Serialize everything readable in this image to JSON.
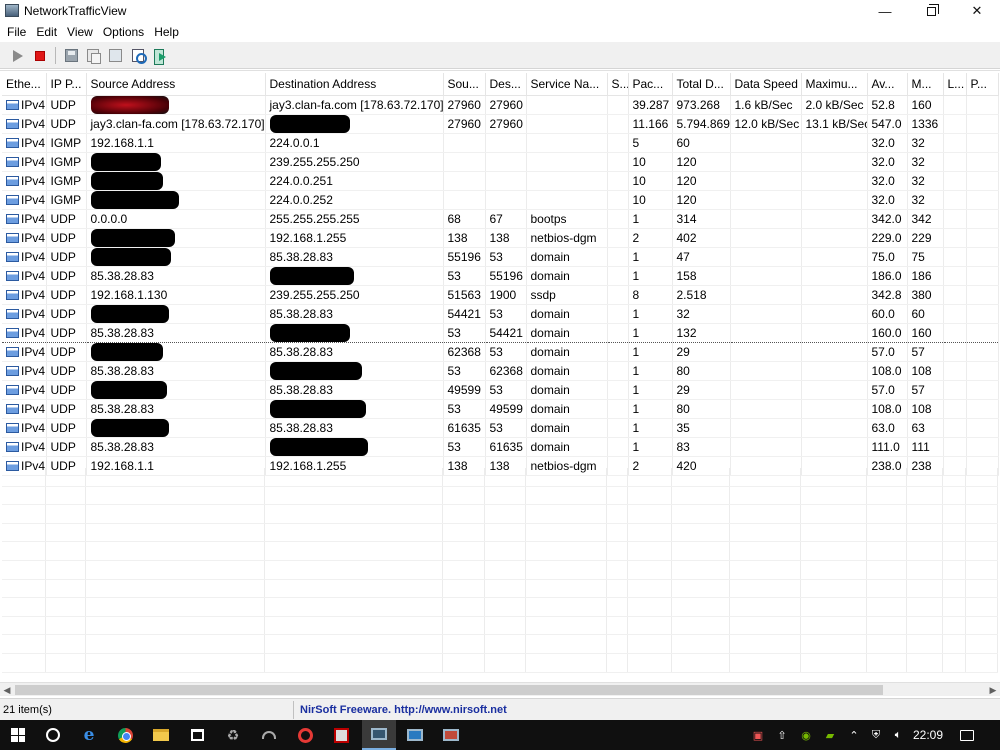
{
  "window": {
    "title": "NetworkTrafficView"
  },
  "menu": [
    "File",
    "Edit",
    "View",
    "Options",
    "Help"
  ],
  "toolbar": {
    "icons": [
      "play-icon",
      "stop-icon",
      "save-icon",
      "copy-icon",
      "html-report-icon",
      "properties-icon",
      "exit-icon"
    ]
  },
  "table": {
    "columns": [
      "Ethe...",
      "IP P...",
      "Source Address",
      "Destination Address",
      "Sou...",
      "Des...",
      "Service Na...",
      "S...",
      "Pac...",
      "Total D...",
      "Data Speed",
      "Maximu...",
      "Av...",
      "M...",
      "L...",
      "P..."
    ],
    "rows": [
      [
        "IPv4",
        "UDP",
        "",
        "jay3.clan-fa.com  [178.63.72.170]",
        "27960",
        "27960",
        "",
        "",
        "39.287",
        "973.268",
        "1.6 kB/Sec",
        "2.0 kB/Sec",
        "52.8",
        "160",
        "",
        ""
      ],
      [
        "IPv4",
        "UDP",
        "jay3.clan-fa.com  [178.63.72.170]",
        "",
        "27960",
        "27960",
        "",
        "",
        "11.166",
        "5.794.869",
        "12.0 kB/Sec",
        "13.1 kB/Sec",
        "547.0",
        "1336",
        "",
        ""
      ],
      [
        "IPv4",
        "IGMP",
        "192.168.1.1",
        "224.0.0.1",
        "",
        "",
        "",
        "",
        "5",
        "60",
        "",
        "",
        "32.0",
        "32",
        "",
        ""
      ],
      [
        "IPv4",
        "IGMP",
        "",
        "239.255.255.250",
        "",
        "",
        "",
        "",
        "10",
        "120",
        "",
        "",
        "32.0",
        "32",
        "",
        ""
      ],
      [
        "IPv4",
        "IGMP",
        "",
        "224.0.0.251",
        "",
        "",
        "",
        "",
        "10",
        "120",
        "",
        "",
        "32.0",
        "32",
        "",
        ""
      ],
      [
        "IPv4",
        "IGMP",
        "",
        "224.0.0.252",
        "",
        "",
        "",
        "",
        "10",
        "120",
        "",
        "",
        "32.0",
        "32",
        "",
        ""
      ],
      [
        "IPv4",
        "UDP",
        "0.0.0.0",
        "255.255.255.255",
        "68",
        "67",
        "bootps",
        "",
        "1",
        "314",
        "",
        "",
        "342.0",
        "342",
        "",
        ""
      ],
      [
        "IPv4",
        "UDP",
        "",
        "192.168.1.255",
        "138",
        "138",
        "netbios-dgm",
        "",
        "2",
        "402",
        "",
        "",
        "229.0",
        "229",
        "",
        ""
      ],
      [
        "IPv4",
        "UDP",
        "",
        "85.38.28.83",
        "55196",
        "53",
        "domain",
        "",
        "1",
        "47",
        "",
        "",
        "75.0",
        "75",
        "",
        ""
      ],
      [
        "IPv4",
        "UDP",
        "85.38.28.83",
        "",
        "53",
        "55196",
        "domain",
        "",
        "1",
        "158",
        "",
        "",
        "186.0",
        "186",
        "",
        ""
      ],
      [
        "IPv4",
        "UDP",
        "192.168.1.130",
        "239.255.255.250",
        "51563",
        "1900",
        "ssdp",
        "",
        "8",
        "2.518",
        "",
        "",
        "342.8",
        "380",
        "",
        ""
      ],
      [
        "IPv4",
        "UDP",
        "",
        "85.38.28.83",
        "54421",
        "53",
        "domain",
        "",
        "1",
        "32",
        "",
        "",
        "60.0",
        "60",
        "",
        ""
      ],
      [
        "IPv4",
        "UDP",
        "85.38.28.83",
        "",
        "53",
        "54421",
        "domain",
        "",
        "1",
        "132",
        "",
        "",
        "160.0",
        "160",
        "",
        ""
      ],
      [
        "IPv4",
        "UDP",
        "",
        "85.38.28.83",
        "62368",
        "53",
        "domain",
        "",
        "1",
        "29",
        "",
        "",
        "57.0",
        "57",
        "",
        ""
      ],
      [
        "IPv4",
        "UDP",
        "85.38.28.83",
        "",
        "53",
        "62368",
        "domain",
        "",
        "1",
        "80",
        "",
        "",
        "108.0",
        "108",
        "",
        ""
      ],
      [
        "IPv4",
        "UDP",
        "",
        "85.38.28.83",
        "49599",
        "53",
        "domain",
        "",
        "1",
        "29",
        "",
        "",
        "57.0",
        "57",
        "",
        ""
      ],
      [
        "IPv4",
        "UDP",
        "85.38.28.83",
        "",
        "53",
        "49599",
        "domain",
        "",
        "1",
        "80",
        "",
        "",
        "108.0",
        "108",
        "",
        ""
      ],
      [
        "IPv4",
        "UDP",
        "",
        "85.38.28.83",
        "61635",
        "53",
        "domain",
        "",
        "1",
        "35",
        "",
        "",
        "63.0",
        "63",
        "",
        ""
      ],
      [
        "IPv4",
        "UDP",
        "85.38.28.83",
        "",
        "53",
        "61635",
        "domain",
        "",
        "1",
        "83",
        "",
        "",
        "111.0",
        "111",
        "",
        ""
      ],
      [
        "IPv4",
        "UDP",
        "192.168.1.1",
        "192.168.1.255",
        "138",
        "138",
        "netbios-dgm",
        "",
        "2",
        "420",
        "",
        "",
        "238.0",
        "238",
        "",
        ""
      ]
    ],
    "redactions": [
      {
        "row": 0,
        "col": 2,
        "style": "red"
      },
      {
        "row": 1,
        "col": 3
      },
      {
        "row": 3,
        "col": 2
      },
      {
        "row": 4,
        "col": 2
      },
      {
        "row": 5,
        "col": 2
      },
      {
        "row": 7,
        "col": 2
      },
      {
        "row": 8,
        "col": 2
      },
      {
        "row": 9,
        "col": 3
      },
      {
        "row": 11,
        "col": 2
      },
      {
        "row": 12,
        "col": 3
      },
      {
        "row": 13,
        "col": 2
      },
      {
        "row": 14,
        "col": 3
      },
      {
        "row": 15,
        "col": 2
      },
      {
        "row": 16,
        "col": 3
      },
      {
        "row": 17,
        "col": 2
      },
      {
        "row": 18,
        "col": 3
      }
    ],
    "focus_row": 12
  },
  "status": {
    "item_count": "21 item(s)",
    "credit": "NirSoft Freeware.  http://www.nirsoft.net"
  },
  "taskbar": {
    "clock": "22:09",
    "apps": [
      "start-icon",
      "cortana-icon",
      "edge-icon",
      "chrome-icon",
      "file-explorer-icon",
      "store-icon",
      "recycle-icon",
      "speed-gauge-icon",
      "red-circle-app-icon",
      "game-app-icon",
      "networktrafficview-task-icon",
      "remote-desktop-icon",
      "network-app-icon"
    ],
    "tray": [
      "media-tray-icon",
      "upload-tray-icon",
      "nvidia-tray-icon",
      "chevron-up-icon",
      "defender-tray-icon",
      "network-tray-icon",
      "volume-tray-icon"
    ]
  }
}
